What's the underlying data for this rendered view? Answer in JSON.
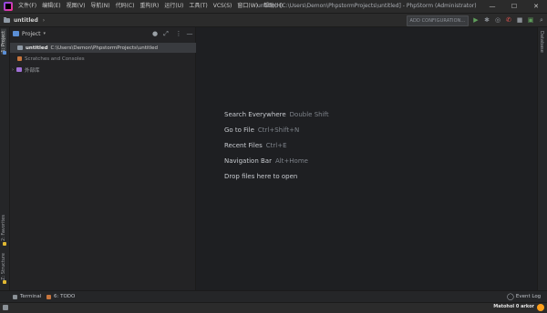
{
  "menu": [
    "文件(F)",
    "编辑(E)",
    "视图(V)",
    "导航(N)",
    "代码(C)",
    "重构(R)",
    "运行(U)",
    "工具(T)",
    "VCS(S)",
    "窗口(W)",
    "帮助(H)"
  ],
  "window_title": "untitled [C:\\Users\\Demon\\PhpstormProjects\\untitled] - PhpStorm (Administrator)",
  "window_controls": {
    "minimize": "—",
    "maximize": "☐",
    "close": "✕"
  },
  "navbar": {
    "crumb": "untitled",
    "sep": "›",
    "add_configuration": "ADD CONFIGURATION..."
  },
  "left_tabs": {
    "project": "1: Project",
    "favorites": "2: Favorites",
    "structure": "Z: Structure"
  },
  "right_tabs": {
    "database": "Database"
  },
  "project_panel": {
    "title": "Project",
    "caret": "▾",
    "tree": {
      "root_name": "untitled",
      "root_path": "C:\\Users\\Demon\\PhpstormProjects\\untitled",
      "scratches": "Scratches and Consoles",
      "external_libs": "外部库"
    }
  },
  "welcome": [
    {
      "action": "Search Everywhere",
      "shortcut": "Double Shift"
    },
    {
      "action": "Go to File",
      "shortcut": "Ctrl+Shift+N"
    },
    {
      "action": "Recent Files",
      "shortcut": "Ctrl+E"
    },
    {
      "action": "Navigation Bar",
      "shortcut": "Alt+Home"
    },
    {
      "action": "Drop files here to open",
      "shortcut": ""
    }
  ],
  "bottom": {
    "terminal": "Terminal",
    "todo": "6: TODO",
    "event_log": "Event Log"
  },
  "watermark": "Matohol 0 arkor",
  "colors": {
    "accent": "#ff9f1a",
    "selected_row": "#393b3f",
    "background": "#1e1f22"
  }
}
